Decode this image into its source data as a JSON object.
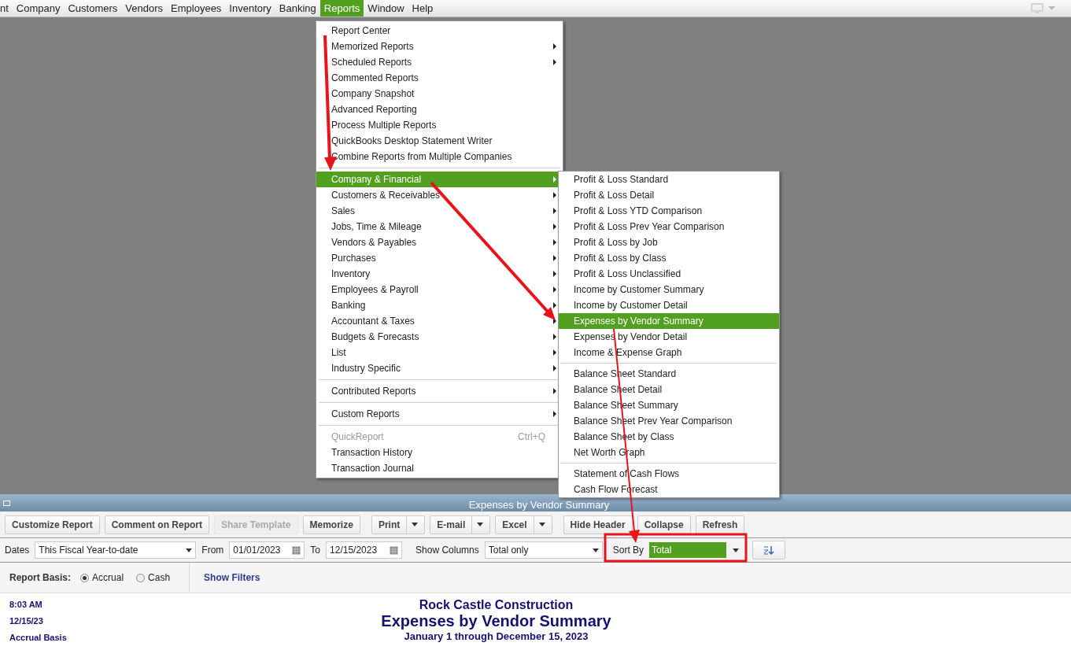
{
  "menubar": [
    {
      "label": "nt",
      "selected": false
    },
    {
      "label": "Company",
      "selected": false
    },
    {
      "label": "Customers",
      "selected": false
    },
    {
      "label": "Vendors",
      "selected": false
    },
    {
      "label": "Employees",
      "selected": false
    },
    {
      "label": "Inventory",
      "selected": false
    },
    {
      "label": "Banking",
      "selected": false
    },
    {
      "label": "Reports",
      "selected": true
    },
    {
      "label": "Window",
      "selected": false
    },
    {
      "label": "Help",
      "selected": false
    }
  ],
  "reports_menu": [
    {
      "kind": "item",
      "label": "Report Center",
      "submenu": false,
      "selected": false,
      "disabled": false
    },
    {
      "kind": "item",
      "label": "Memorized Reports",
      "submenu": true,
      "selected": false,
      "disabled": false
    },
    {
      "kind": "item",
      "label": "Scheduled Reports",
      "submenu": true,
      "selected": false,
      "disabled": false
    },
    {
      "kind": "item",
      "label": "Commented Reports",
      "submenu": false,
      "selected": false,
      "disabled": false
    },
    {
      "kind": "item",
      "label": "Company Snapshot",
      "submenu": false,
      "selected": false,
      "disabled": false
    },
    {
      "kind": "item",
      "label": "Advanced Reporting",
      "submenu": false,
      "selected": false,
      "disabled": false
    },
    {
      "kind": "item",
      "label": "Process Multiple Reports",
      "submenu": false,
      "selected": false,
      "disabled": false
    },
    {
      "kind": "item",
      "label": "QuickBooks Desktop Statement Writer",
      "submenu": false,
      "selected": false,
      "disabled": false
    },
    {
      "kind": "item",
      "label": "Combine Reports from Multiple Companies",
      "submenu": false,
      "selected": false,
      "disabled": false
    },
    {
      "kind": "separator"
    },
    {
      "kind": "item",
      "label": "Company & Financial",
      "submenu": true,
      "selected": true,
      "disabled": false
    },
    {
      "kind": "item",
      "label": "Customers & Receivables",
      "submenu": true,
      "selected": false,
      "disabled": false
    },
    {
      "kind": "item",
      "label": "Sales",
      "submenu": true,
      "selected": false,
      "disabled": false
    },
    {
      "kind": "item",
      "label": "Jobs, Time & Mileage",
      "submenu": true,
      "selected": false,
      "disabled": false
    },
    {
      "kind": "item",
      "label": "Vendors & Payables",
      "submenu": true,
      "selected": false,
      "disabled": false
    },
    {
      "kind": "item",
      "label": "Purchases",
      "submenu": true,
      "selected": false,
      "disabled": false
    },
    {
      "kind": "item",
      "label": "Inventory",
      "submenu": true,
      "selected": false,
      "disabled": false
    },
    {
      "kind": "item",
      "label": "Employees & Payroll",
      "submenu": true,
      "selected": false,
      "disabled": false
    },
    {
      "kind": "item",
      "label": "Banking",
      "submenu": true,
      "selected": false,
      "disabled": false
    },
    {
      "kind": "item",
      "label": "Accountant & Taxes",
      "submenu": true,
      "selected": false,
      "disabled": false
    },
    {
      "kind": "item",
      "label": "Budgets & Forecasts",
      "submenu": true,
      "selected": false,
      "disabled": false
    },
    {
      "kind": "item",
      "label": "List",
      "submenu": true,
      "selected": false,
      "disabled": false
    },
    {
      "kind": "item",
      "label": "Industry Specific",
      "submenu": true,
      "selected": false,
      "disabled": false
    },
    {
      "kind": "separator"
    },
    {
      "kind": "item",
      "label": "Contributed Reports",
      "submenu": true,
      "selected": false,
      "disabled": false
    },
    {
      "kind": "separator"
    },
    {
      "kind": "item",
      "label": "Custom Reports",
      "submenu": true,
      "selected": false,
      "disabled": false
    },
    {
      "kind": "separator"
    },
    {
      "kind": "item",
      "label": "QuickReport",
      "submenu": false,
      "selected": false,
      "disabled": true,
      "shortcut": "Ctrl+Q"
    },
    {
      "kind": "item",
      "label": "Transaction History",
      "submenu": false,
      "selected": false,
      "disabled": false
    },
    {
      "kind": "item",
      "label": "Transaction Journal",
      "submenu": false,
      "selected": false,
      "disabled": false
    }
  ],
  "company_financial_menu": [
    {
      "kind": "item",
      "label": "Profit & Loss Standard",
      "selected": false
    },
    {
      "kind": "item",
      "label": "Profit & Loss Detail",
      "selected": false
    },
    {
      "kind": "item",
      "label": "Profit & Loss YTD Comparison",
      "selected": false
    },
    {
      "kind": "item",
      "label": "Profit & Loss Prev Year Comparison",
      "selected": false
    },
    {
      "kind": "item",
      "label": "Profit & Loss by Job",
      "selected": false
    },
    {
      "kind": "item",
      "label": "Profit & Loss by Class",
      "selected": false
    },
    {
      "kind": "item",
      "label": "Profit & Loss Unclassified",
      "selected": false
    },
    {
      "kind": "item",
      "label": "Income by Customer Summary",
      "selected": false
    },
    {
      "kind": "item",
      "label": "Income by Customer Detail",
      "selected": false
    },
    {
      "kind": "item",
      "label": "Expenses by Vendor Summary",
      "selected": true
    },
    {
      "kind": "item",
      "label": "Expenses by Vendor Detail",
      "selected": false
    },
    {
      "kind": "item",
      "label": "Income & Expense Graph",
      "selected": false
    },
    {
      "kind": "separator"
    },
    {
      "kind": "item",
      "label": "Balance Sheet Standard",
      "selected": false
    },
    {
      "kind": "item",
      "label": "Balance Sheet Detail",
      "selected": false
    },
    {
      "kind": "item",
      "label": "Balance Sheet Summary",
      "selected": false
    },
    {
      "kind": "item",
      "label": "Balance Sheet Prev Year Comparison",
      "selected": false
    },
    {
      "kind": "item",
      "label": "Balance Sheet by Class",
      "selected": false
    },
    {
      "kind": "item",
      "label": "Net Worth Graph",
      "selected": false
    },
    {
      "kind": "separator"
    },
    {
      "kind": "item",
      "label": "Statement of Cash Flows",
      "selected": false
    },
    {
      "kind": "item",
      "label": "Cash Flow Forecast",
      "selected": false
    }
  ],
  "report_window": {
    "title": "Expenses by Vendor Summary",
    "toolbar": [
      {
        "label": "Customize Report",
        "disabled": false,
        "dropdown": false
      },
      {
        "label": "Comment on Report",
        "disabled": false,
        "dropdown": false
      },
      {
        "label": "Share Template",
        "disabled": true,
        "dropdown": false
      },
      {
        "label": "Memorize",
        "disabled": false,
        "dropdown": false
      },
      {
        "label": "Print",
        "disabled": false,
        "dropdown": true
      },
      {
        "label": "E-mail",
        "disabled": false,
        "dropdown": true
      },
      {
        "label": "Excel",
        "disabled": false,
        "dropdown": true
      },
      {
        "label": "Hide Header",
        "disabled": false,
        "dropdown": false
      },
      {
        "label": "Collapse",
        "disabled": false,
        "dropdown": false
      },
      {
        "label": "Refresh",
        "disabled": false,
        "dropdown": false
      }
    ],
    "filters": {
      "dates_label": "Dates",
      "dates_value": "This Fiscal Year-to-date",
      "from_label": "From",
      "from_value": "01/01/2023",
      "to_label": "To",
      "to_value": "12/15/2023",
      "show_columns_label": "Show Columns",
      "show_columns_value": "Total only",
      "sort_by_label": "Sort By",
      "sort_by_value": "Total",
      "sort_by_highlighted": true
    },
    "basis": {
      "label": "Report Basis:",
      "options": [
        {
          "label": "Accrual",
          "selected": true
        },
        {
          "label": "Cash",
          "selected": false
        }
      ]
    },
    "show_filters": "Show Filters",
    "header": {
      "time": "8:03 AM",
      "date": "12/15/23",
      "basis": "Accrual Basis",
      "company": "Rock Castle Construction",
      "title": "Expenses by Vendor Summary",
      "period": "January 1 through December 15, 2023"
    }
  }
}
